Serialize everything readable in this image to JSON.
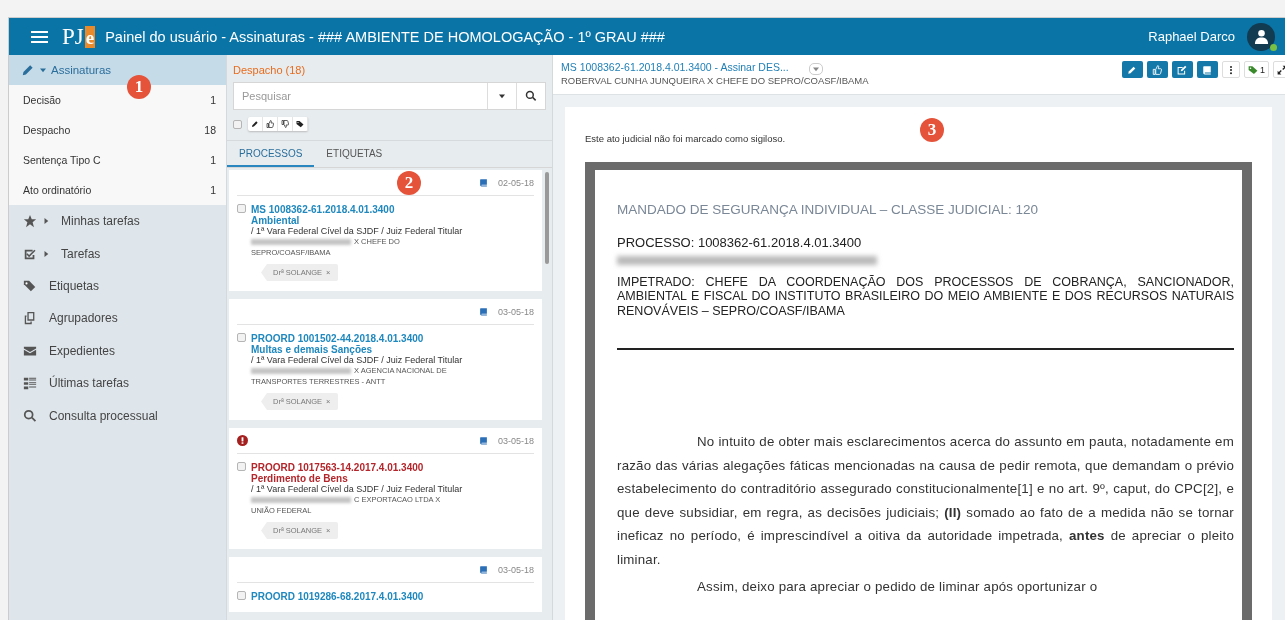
{
  "header": {
    "logo": {
      "main": "PJ",
      "accent": "e"
    },
    "title": "Painel do usuário - Assinaturas - ### AMBIENTE DE HOMOLOGAÇÃO - 1º GRAU ###",
    "user_name": "Raphael Darco",
    "online": true
  },
  "sidebar": {
    "annotation": "1",
    "items": [
      {
        "label": "Assinaturas",
        "expanded": true,
        "selected": true,
        "children": [
          {
            "label": "Decisão",
            "count": "1"
          },
          {
            "label": "Despacho",
            "count": "18"
          },
          {
            "label": "Sentença Tipo C",
            "count": "1"
          },
          {
            "label": "Ato ordinatório",
            "count": "1"
          }
        ]
      },
      {
        "label": "Minhas tarefas",
        "expanded": false,
        "selected": false
      },
      {
        "label": "Tarefas",
        "expanded": false,
        "selected": false
      },
      {
        "label": "Etiquetas",
        "selected": false
      },
      {
        "label": "Agrupadores",
        "selected": false
      },
      {
        "label": "Expedientes",
        "selected": false
      },
      {
        "label": "Últimas tarefas",
        "selected": false
      },
      {
        "label": "Consulta processual",
        "selected": false
      }
    ]
  },
  "list": {
    "heading": "Despacho (18)",
    "search": {
      "placeholder": "Pesquisar"
    },
    "select_all": {
      "checked": false
    },
    "tabs": [
      {
        "label": "PROCESSOS",
        "selected": true
      },
      {
        "label": "ETIQUETAS",
        "selected": false
      }
    ],
    "annotation": "2",
    "cards": [
      {
        "alert": false,
        "date": "02-05-18",
        "checked": false,
        "number": "MS 1008362-61.2018.4.01.3400",
        "subject": "Ambiental",
        "court": "/ 1ª Vara Federal Cível da SJDF / Juiz Federal Titular",
        "parties": {
          "tail": "X CHEFE DO",
          "line_2": "SEPRO/COASF/IBAMA"
        },
        "tags": [
          {
            "label": "Drª SOLANGE",
            "remove": "×"
          }
        ]
      },
      {
        "alert": false,
        "date": "03-05-18",
        "checked": false,
        "number": "PROORD 1001502-44.2018.4.01.3400",
        "subject": "Multas e demais Sanções",
        "court": "/ 1ª Vara Federal Cível da SJDF / Juiz Federal Titular",
        "parties": {
          "tail": "X AGENCIA NACIONAL DE",
          "line_2": "TRANSPORTES TERRESTRES - ANTT"
        },
        "tags": [
          {
            "label": "Drª SOLANGE",
            "remove": "×"
          }
        ]
      },
      {
        "alert": true,
        "date": "03-05-18",
        "checked": false,
        "number": "PROORD 1017563-14.2017.4.01.3400",
        "subject": "Perdimento de Bens",
        "court": "/ 1ª Vara Federal Cível da SJDF / Juiz Federal Titular",
        "parties": {
          "tail": "C EXPORTACAO LTDA X",
          "line_2": "UNIÃO FEDERAL"
        },
        "tags": [
          {
            "label": "Drª SOLANGE",
            "remove": "×"
          }
        ]
      },
      {
        "alert": false,
        "date": "03-05-18",
        "checked": false,
        "number": "PROORD 1019286-68.2017.4.01.3400"
      }
    ]
  },
  "viewer": {
    "title_link": "MS 1008362-61.2018.4.01.3400 - Assinar DES...",
    "subtitle": "ROBERVAL CUNHA JUNQUEIRA X CHEFE DO SEPRO/COASF/IBAMA",
    "tag_count": "1",
    "notice": "Este ato judicial não foi marcado como sigiloso.",
    "annotation": "3",
    "document": {
      "class_line": "MANDADO DE SEGURANÇA INDIVIDUAL – CLASSE JUDICIAL: 120",
      "process": "PROCESSO: 1008362-61.2018.4.01.3400",
      "respondent": "IMPETRADO: CHEFE DA COORDENAÇÃO DOS PROCESSOS DE COBRANÇA, SANCIONADOR, AMBIENTAL E FISCAL DO INSTITUTO BRASILEIRO DO MEIO AMBIENTE E DOS RECURSOS NATURAIS RENOVÁVEIS – SEPRO/COASF/IBAMA",
      "paragraphs": [
        "No intuito de obter mais esclarecimentos acerca do assunto em pauta, notadamente em razão das várias alegações fáticas mencionadas na causa de pedir remota, que demandam o prévio estabelecimento do contraditório assegurado constitucionalmente[1] e no art. 9º, caput, do CPC[2], e que deve subsidiar, em regra, as decisões judiciais; **(II)** somado ao fato de a medida não se tornar ineficaz no período, é imprescindível a oitiva da autoridade impetrada, **antes** de apreciar o pleito liminar.",
        "Assim, deixo para apreciar o pedido de liminar após oportunizar o"
      ]
    }
  }
}
